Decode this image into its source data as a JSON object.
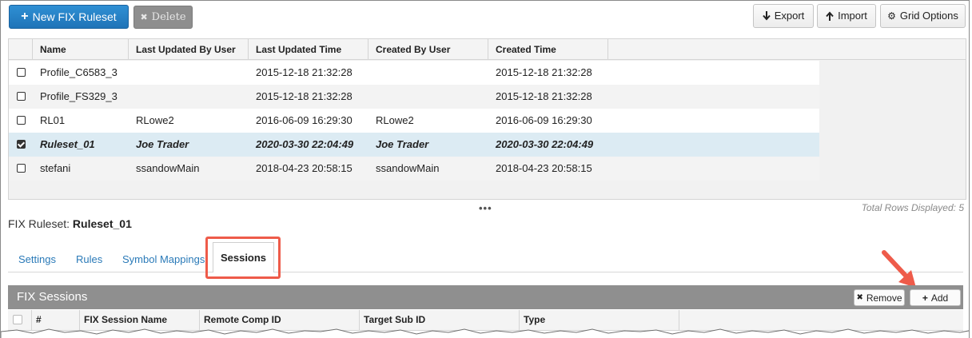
{
  "toolbar": {
    "new_label": "New FIX Ruleset",
    "delete_label": "Delete",
    "export_label": "Export",
    "import_label": "Import",
    "grid_options_label": "Grid Options"
  },
  "grid": {
    "columns": [
      "Name",
      "Last Updated By User",
      "Last Updated Time",
      "Created By User",
      "Created Time"
    ],
    "rows": [
      {
        "checked": false,
        "name": "Profile_C6583_3",
        "updated_by": "",
        "updated_time": "2015-12-18 21:32:28",
        "created_by": "",
        "created_time": "2015-12-18 21:32:28"
      },
      {
        "checked": false,
        "name": "Profile_FS329_3",
        "updated_by": "",
        "updated_time": "2015-12-18 21:32:28",
        "created_by": "",
        "created_time": "2015-12-18 21:32:28"
      },
      {
        "checked": false,
        "name": "RL01",
        "updated_by": "RLowe2",
        "updated_time": "2016-06-09 16:29:30",
        "created_by": "RLowe2",
        "created_time": "2016-06-09 16:29:30"
      },
      {
        "checked": true,
        "name": "Ruleset_01",
        "updated_by": "Joe Trader",
        "updated_time": "2020-03-30 22:04:49",
        "created_by": "Joe Trader",
        "created_time": "2020-03-30 22:04:49"
      },
      {
        "checked": false,
        "name": "stefani",
        "updated_by": "ssandowMain",
        "updated_time": "2018-04-23 20:58:15",
        "created_by": "ssandowMain",
        "created_time": "2018-04-23 20:58:15"
      }
    ],
    "ellipsis": "•••",
    "total_rows": "Total Rows Displayed: 5"
  },
  "detail": {
    "label": "FIX Ruleset:",
    "name": "Ruleset_01"
  },
  "tabs": [
    "Settings",
    "Rules",
    "Symbol Mappings",
    "Sessions"
  ],
  "sessions": {
    "title": "FIX Sessions",
    "remove_label": "Remove",
    "add_label": "Add",
    "columns": [
      "#",
      "FIX Session Name",
      "Remote Comp ID",
      "Target Sub ID",
      "Type"
    ]
  },
  "colors": {
    "primary": "#1f74b8",
    "selected_row": "#dcebf3",
    "highlight": "#ee5b4a",
    "link": "#2a7ab8"
  }
}
